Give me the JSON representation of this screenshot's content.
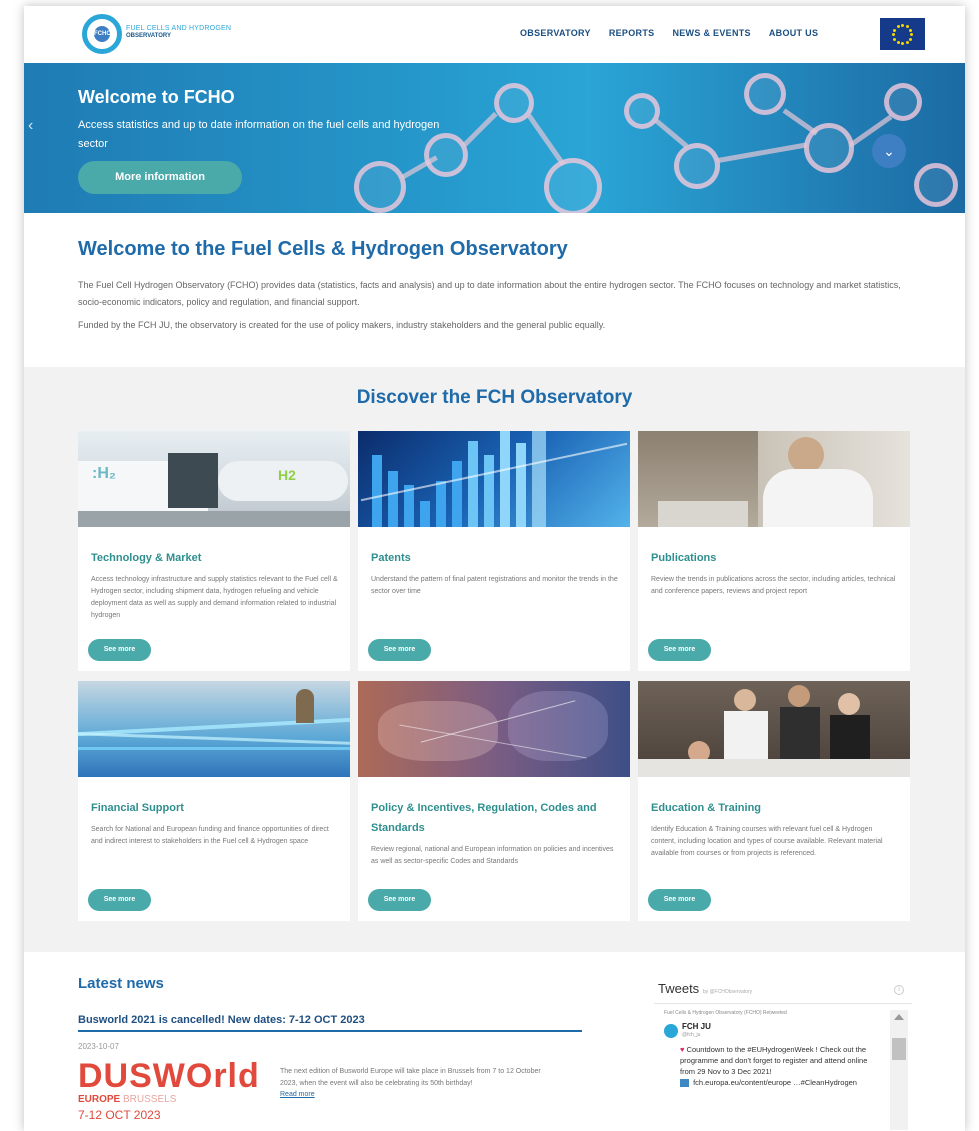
{
  "header": {
    "logo_line1": "FUEL CELLS AND HYDROGEN",
    "logo_line2": "OBSERVATORY",
    "logo_mark": "FCHO",
    "nav": [
      "OBSERVATORY",
      "REPORTS",
      "NEWS & EVENTS",
      "ABOUT US"
    ]
  },
  "hero": {
    "title": "Welcome to FCHO",
    "subtitle": "Access statistics and up to date information on the fuel cells and hydrogen sector",
    "button": "More information",
    "prev_arrow": "‹",
    "down_arrow": "⌄"
  },
  "intro": {
    "title": "Welcome to the Fuel Cells & Hydrogen Observatory",
    "paragraph1": "The Fuel Cell Hydrogen Observatory (FCHO) provides data (statistics, facts and analysis) and up to date information about the entire hydrogen sector. The FCHO focuses on technology and market statistics, socio-economic indicators, policy and regulation, and financial support.",
    "paragraph2": "Funded by the FCH JU, the observatory is created for the use of policy makers, industry stakeholders and the general public equally."
  },
  "discover": {
    "title": "Discover the FCH Observatory",
    "cards": [
      {
        "title": "Technology & Market",
        "desc": "Access technology infrastructure and supply statistics relevant to the Fuel cell & Hydrogen sector, including shipment data, hydrogen refueling and vehicle deployment data as well as supply and demand information related to industrial hydrogen",
        "button": "See more"
      },
      {
        "title": "Patents",
        "desc": "Understand the pattern of final patent registrations and monitor the trends in the sector over time",
        "button": "See more"
      },
      {
        "title": "Publications",
        "desc": "Review the trends in publications across the sector, including articles, technical and conference papers, reviews and project report",
        "button": "See more"
      },
      {
        "title": "Financial Support",
        "desc": "Search for National and European funding and finance opportunities of direct and indirect interest to stakeholders in the Fuel cell & Hydrogen space",
        "button": "See more"
      },
      {
        "title": "Policy & Incentives, Regulation, Codes and Standards",
        "desc": "Review regional, national and European information on policies and incentives as well as sector-specific Codes and Standards",
        "button": "See more"
      },
      {
        "title": "Education & Training",
        "desc": "Identify Education & Training courses with relevant fuel cell & Hydrogen content, including location and types of course available. Relevant material available from courses or from projects is referenced.",
        "button": "See more"
      }
    ]
  },
  "news": {
    "title": "Latest news",
    "headline": "Busworld 2021 is cancelled! New dates: 7-12 OCT 2023",
    "date": "2023-10-07",
    "logo_main": "DUSWOrld",
    "logo_sub_bold": "EUROPE",
    "logo_sub_light": "BRUSSELS",
    "logo_dates": "7-12 OCT 2023",
    "text": "The next edition of Busworld Europe will take place in Brussels from 7 to 12 October 2023, when the event will also be celebrating its 50th birthday!",
    "read_more": "Read more"
  },
  "tweets": {
    "title": "Tweets",
    "by": "by @FCHObservatory",
    "info": "i",
    "retweet_line": "Fuel Cells & Hydrogen Observatory (FCHO) Retweeted",
    "name": "FCH JU",
    "handle": "@fch_ju",
    "heart": "♥",
    "text": "Countdown to the #EUHydrogenWeek ! Check out the programme and don't forget to register and attend online from 29 Nov to 3 Dec 2021!",
    "link_text": "fch.europa.eu/content/europe …#CleanHydrogen"
  }
}
